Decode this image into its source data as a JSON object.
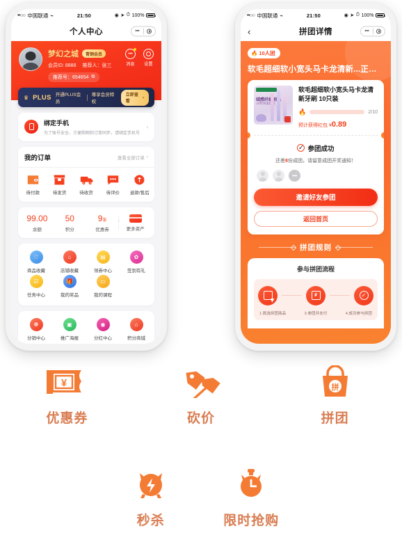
{
  "status_bar": {
    "signal_dots": "••○○",
    "carrier": "中国联通",
    "wifi_icon": "wifi-icon",
    "time": "21:50",
    "battery_percent": "100%"
  },
  "phone_left": {
    "nav": {
      "title": "个人中心",
      "capsule_dots": "•••",
      "capsule_circle_icon": "target-icon"
    },
    "profile": {
      "avatar_icon": "user-avatar",
      "name": "梦幻之城",
      "member_badge": "青铜会员",
      "member_id_label": "会员ID: 8888",
      "referrer_label": "推荐人：张三",
      "referral_code_label": "推荐号：654654",
      "copy_icon": "copy-icon",
      "actions": [
        {
          "label": "消息",
          "icon": "message-icon",
          "has_dot": true
        },
        {
          "label": "设置",
          "icon": "gear-icon",
          "has_dot": false
        }
      ]
    },
    "plus_banner": {
      "crown_icon": "crown-icon",
      "brand": "PLUS",
      "text_1": "开通PLUS会员",
      "text_2": "尊享会员特权",
      "button_label": "立即查看"
    },
    "bind_phone": {
      "icon": "phone-icon",
      "title": "绑定手机",
      "desc": "为了账号安全、方便购物和订单同步，请绑定手机号",
      "chevron_icon": "chevron-right-icon"
    },
    "orders": {
      "title": "我的订单",
      "more_label": "查看全部订单",
      "more_chevron_icon": "chevron-right-icon",
      "items": [
        {
          "label": "待付款",
          "icon": "wallet-icon"
        },
        {
          "label": "待发货",
          "icon": "box-icon"
        },
        {
          "label": "待收货",
          "icon": "truck-icon"
        },
        {
          "label": "待评价",
          "icon": "comment-icon"
        },
        {
          "label": "退款/售后",
          "icon": "refund-icon"
        }
      ]
    },
    "assets": {
      "items": [
        {
          "value": "99.00",
          "unit": "",
          "label": "余额"
        },
        {
          "value": "50",
          "unit": "",
          "label": "积分"
        },
        {
          "value": "9",
          "unit": "张",
          "label": "优惠券"
        }
      ],
      "more_label": "更多资产",
      "more_icon": "card-icon",
      "arrow_icon": "chevron-right-icon"
    },
    "grid_a": [
      {
        "label": "商品收藏",
        "icon": "heart-collect-icon",
        "color": "#5aa9f0"
      },
      {
        "label": "店铺收藏",
        "icon": "shop-collect-icon",
        "color": "#f4533a"
      },
      {
        "label": "领券中心",
        "icon": "coupon-center-icon",
        "color": "#fbc02d"
      },
      {
        "label": "签到有礼",
        "icon": "signin-gift-icon",
        "color": "#e84aa0"
      },
      {
        "label": "任务中心",
        "icon": "task-icon",
        "color": "#fbc02d"
      },
      {
        "label": "我的奖品",
        "icon": "prize-icon",
        "color": "#4a8ef0"
      },
      {
        "label": "我的课程",
        "icon": "course-icon",
        "color": "#fbb01d"
      }
    ],
    "grid_b": [
      {
        "label": "分销中心",
        "icon": "distribution-icon",
        "color": "#f4533a"
      },
      {
        "label": "推广海报",
        "icon": "poster-icon",
        "color": "#37c26a"
      },
      {
        "label": "分红中心",
        "icon": "dividend-icon",
        "color": "#e8359a"
      },
      {
        "label": "积分商城",
        "icon": "points-mall-icon",
        "color": "#f4533a"
      }
    ]
  },
  "phone_right": {
    "nav": {
      "back_icon": "chevron-left-icon",
      "title": "拼团详情",
      "capsule_dots": "•••",
      "capsule_circle_icon": "target-icon"
    },
    "banner": {
      "tag_flame_icon": "flame-icon",
      "tag_label": "10人团",
      "headline": "软毛超细软小宽头马卡龙清新...正在疯抢中"
    },
    "product": {
      "image_icon": "toothbrush-package-image",
      "image_badge_text": "绒感纤细刷毛",
      "image_sub_text": "15秒快速起泡",
      "title": "软毛超细软小宽头马卡龙清新牙刷 10只装",
      "flame_icon": "flame-icon",
      "progress_text": "2/10",
      "progress_current": 2,
      "progress_total": 10,
      "redpack_label": "预计获得红包",
      "redpack_currency": "¥",
      "redpack_amount": "0.89"
    },
    "result": {
      "check_icon": "check-circle-icon",
      "title": "参团成功",
      "desc_prefix": "还差",
      "desc_count": "8",
      "desc_suffix": "份成团，请留意成团开奖通知！",
      "member_avatars": [
        "avatar-placeholder",
        "avatar-placeholder"
      ],
      "more_avatar": "•••",
      "invite_button": "邀请好友参团",
      "home_button": "返回首页"
    },
    "rules": {
      "section_title": "拼团规则",
      "sub_title": "参与拼团流程",
      "steps": [
        {
          "label": "1.挑选拼团商品",
          "icon": "select-product-icon"
        },
        {
          "label": "3.参团并支付",
          "icon": "pay-icon"
        },
        {
          "label": "4.成功参与拼团",
          "icon": "check-circle-icon"
        }
      ]
    }
  },
  "features": {
    "accent_color": "#f47b34",
    "label_color": "#d97d52",
    "row_1": [
      {
        "label": "优惠券",
        "icon": "coupon-ticket-icon"
      },
      {
        "label": "砍价",
        "icon": "price-tags-icon"
      },
      {
        "label": "拼团",
        "icon": "group-bag-icon"
      }
    ],
    "row_2": [
      {
        "label": "秒杀",
        "icon": "alarm-flash-icon"
      },
      {
        "label": "限时抢购",
        "icon": "stopwatch-icon"
      }
    ]
  }
}
